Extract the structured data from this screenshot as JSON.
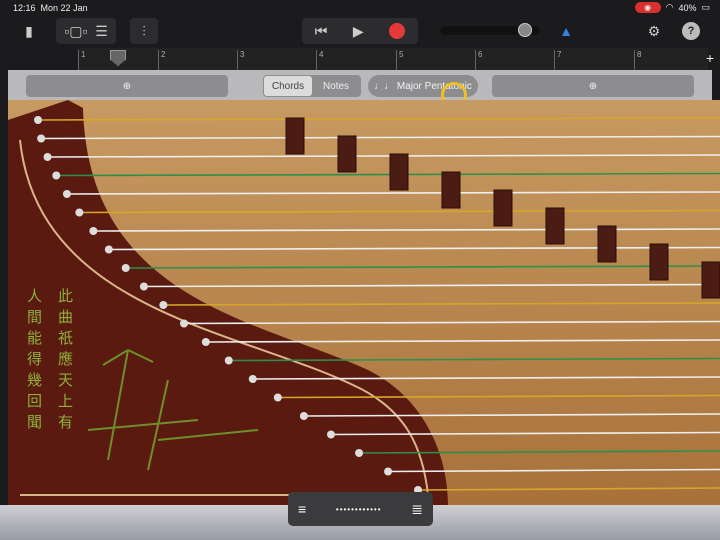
{
  "status": {
    "time": "12:16",
    "date": "Mon 22 Jan",
    "battery": "40%"
  },
  "toolbar": {
    "icons": [
      "document-icon",
      "tracks-view-icon",
      "list-view-icon",
      "mixer-icon",
      "rewind-icon",
      "play-icon",
      "record-icon",
      "metronome-icon",
      "settings-icon",
      "help-icon"
    ],
    "record_color": "#e5383b"
  },
  "ruler": {
    "bars": [
      "1",
      "2",
      "3",
      "4",
      "5",
      "6",
      "7",
      "8"
    ],
    "add": "+"
  },
  "controls": {
    "chords": "Chords",
    "notes": "Notes",
    "active": "Chords",
    "scale": "Major Pentatonic"
  },
  "poem": {
    "col_right": "此曲祇應天上有",
    "col_left": "人間能得幾回聞"
  },
  "colors": {
    "wood": "#b9834a",
    "body": "#5a1a10",
    "gold": "#d7a52a",
    "green": "#2f8f4a"
  }
}
